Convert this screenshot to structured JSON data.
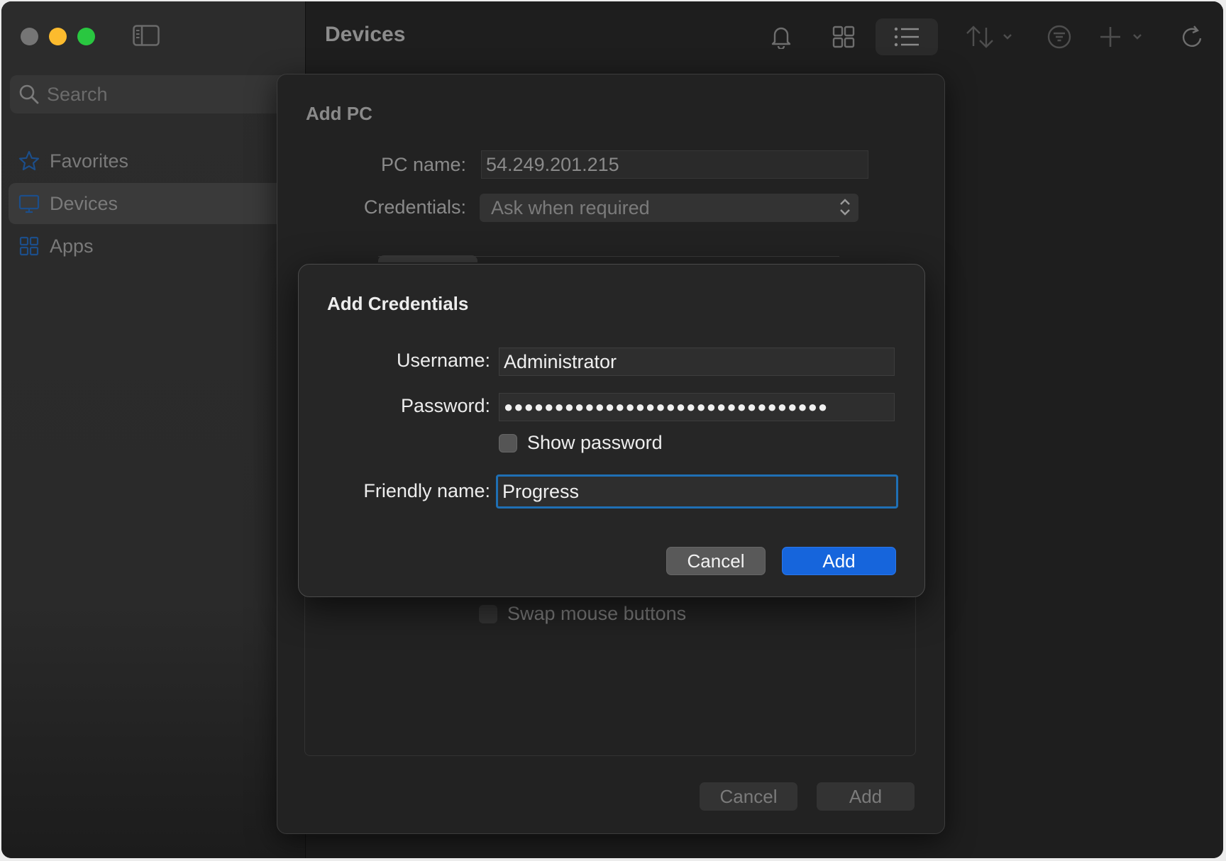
{
  "window": {
    "title": "Devices"
  },
  "sidebar": {
    "search_placeholder": "Search",
    "items": [
      {
        "label": "Favorites",
        "icon": "star-icon"
      },
      {
        "label": "Devices",
        "icon": "monitor-icon",
        "active": true
      },
      {
        "label": "Apps",
        "icon": "apps-grid-icon"
      }
    ]
  },
  "toolbar": {
    "icons": [
      "bell-icon",
      "grid-view-icon",
      "list-view-icon",
      "sort-icon",
      "filter-icon",
      "add-icon",
      "refresh-icon"
    ]
  },
  "add_pc": {
    "title": "Add PC",
    "pc_name_label": "PC name:",
    "pc_name_value": "54.249.201.215",
    "credentials_label": "Credentials:",
    "credentials_value": "Ask when required",
    "swap_mouse_label": "Swap mouse buttons",
    "cancel_label": "Cancel",
    "add_label": "Add"
  },
  "add_credentials": {
    "title": "Add Credentials",
    "username_label": "Username:",
    "username_value": "Administrator",
    "password_label": "Password:",
    "password_value": "●●●●●●●●●●●●●●●●●●●●●●●●●●●●●●●●",
    "show_password_label": "Show password",
    "friendly_name_label": "Friendly name:",
    "friendly_name_value": "Progress",
    "cancel_label": "Cancel",
    "add_label": "Add"
  },
  "colors": {
    "accent": "#1665dc",
    "focus_ring": "#1f6fb4",
    "traffic_close": "#757575",
    "traffic_minimize": "#fcbb2e",
    "traffic_maximize": "#29c740"
  }
}
